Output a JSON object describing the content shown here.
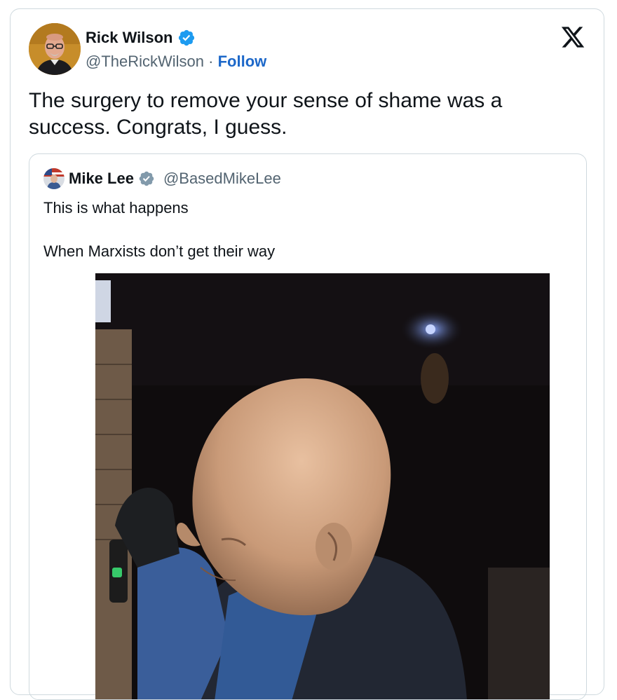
{
  "tweet": {
    "author_name": "Rick Wilson",
    "author_handle": "@TheRickWilson",
    "separator": "·",
    "follow_label": "Follow",
    "text_line1": "The surgery to remove your sense of shame was a",
    "text_line2": "success. Congrats, I guess."
  },
  "quoted_tweet": {
    "author_name": "Mike Lee",
    "author_handle": "@BasedMikeLee",
    "text_line1": "This is what happens",
    "text_line2": "When Marxists don’t get their way"
  },
  "colors": {
    "verified_badge": "#1d9bf0",
    "quoted_verified_badge": "#829aab",
    "follow_link": "#1d68c9",
    "secondary_text": "#536471",
    "border": "#cfd9de"
  },
  "icons": {
    "x_logo": "x-logo-icon",
    "verified": "verified-badge-icon"
  }
}
